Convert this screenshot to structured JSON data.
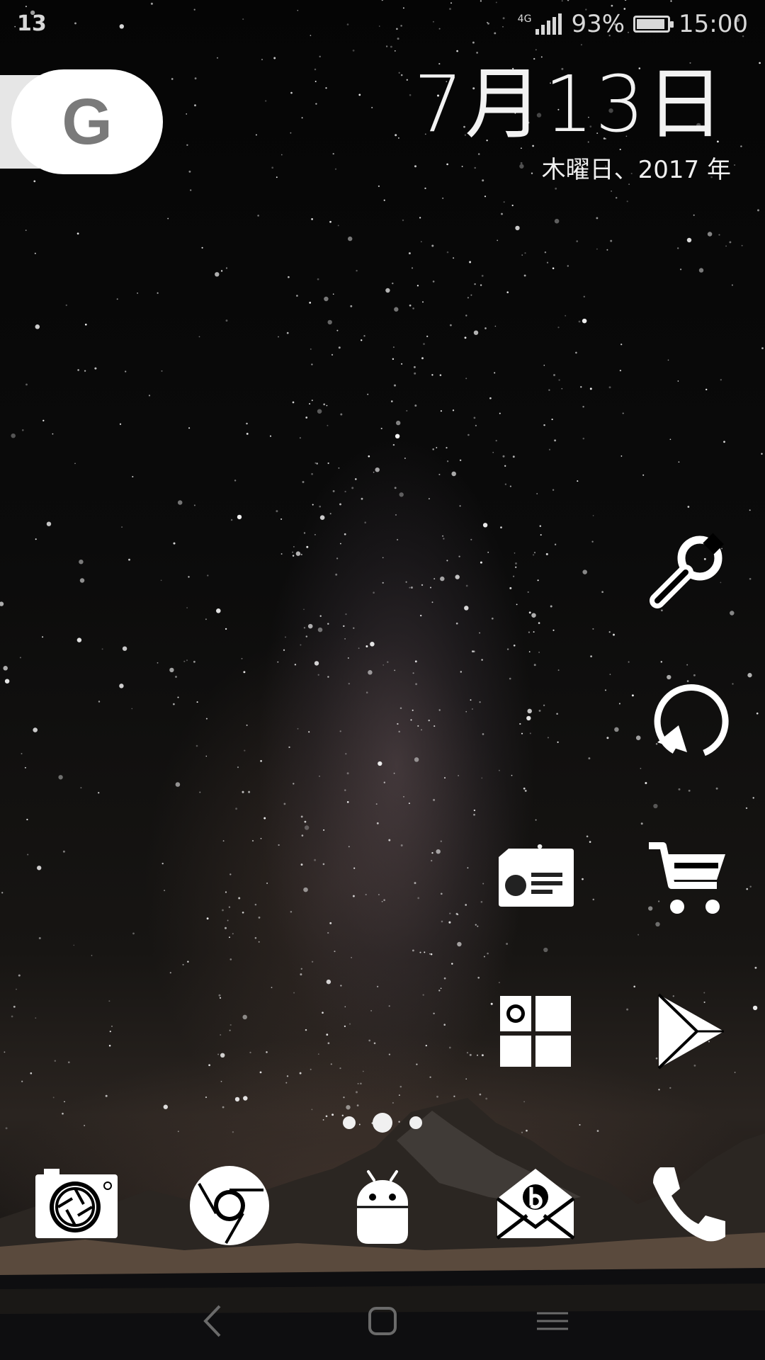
{
  "status_bar": {
    "notification_count": "13",
    "network_type": "4G",
    "battery_percent": "93%",
    "battery_level": 0.93,
    "time": "15:00"
  },
  "google_widget": {
    "logo_letter": "G"
  },
  "date_widget": {
    "date": "7月13日",
    "weekday_year": "木曜日、2017 年"
  },
  "home_icons": [
    {
      "name": "settings-wrench-icon"
    },
    {
      "name": "sync-refresh-icon"
    },
    {
      "name": "contact-card-icon"
    },
    {
      "name": "shopping-cart-icon"
    },
    {
      "name": "gallery-grid-icon"
    },
    {
      "name": "play-store-icon"
    }
  ],
  "page_indicator": {
    "pages": 3,
    "current_page": 2
  },
  "dock": [
    {
      "name": "camera-icon"
    },
    {
      "name": "chrome-browser-icon"
    },
    {
      "name": "android-robot-icon"
    },
    {
      "name": "email-icon"
    },
    {
      "name": "phone-icon"
    }
  ],
  "navigation": {
    "buttons": [
      "back",
      "home",
      "recents"
    ]
  },
  "colors": {
    "icon": "#ffffff",
    "status_text": "#d8d8d8",
    "google_g": "#7a7a7a"
  }
}
